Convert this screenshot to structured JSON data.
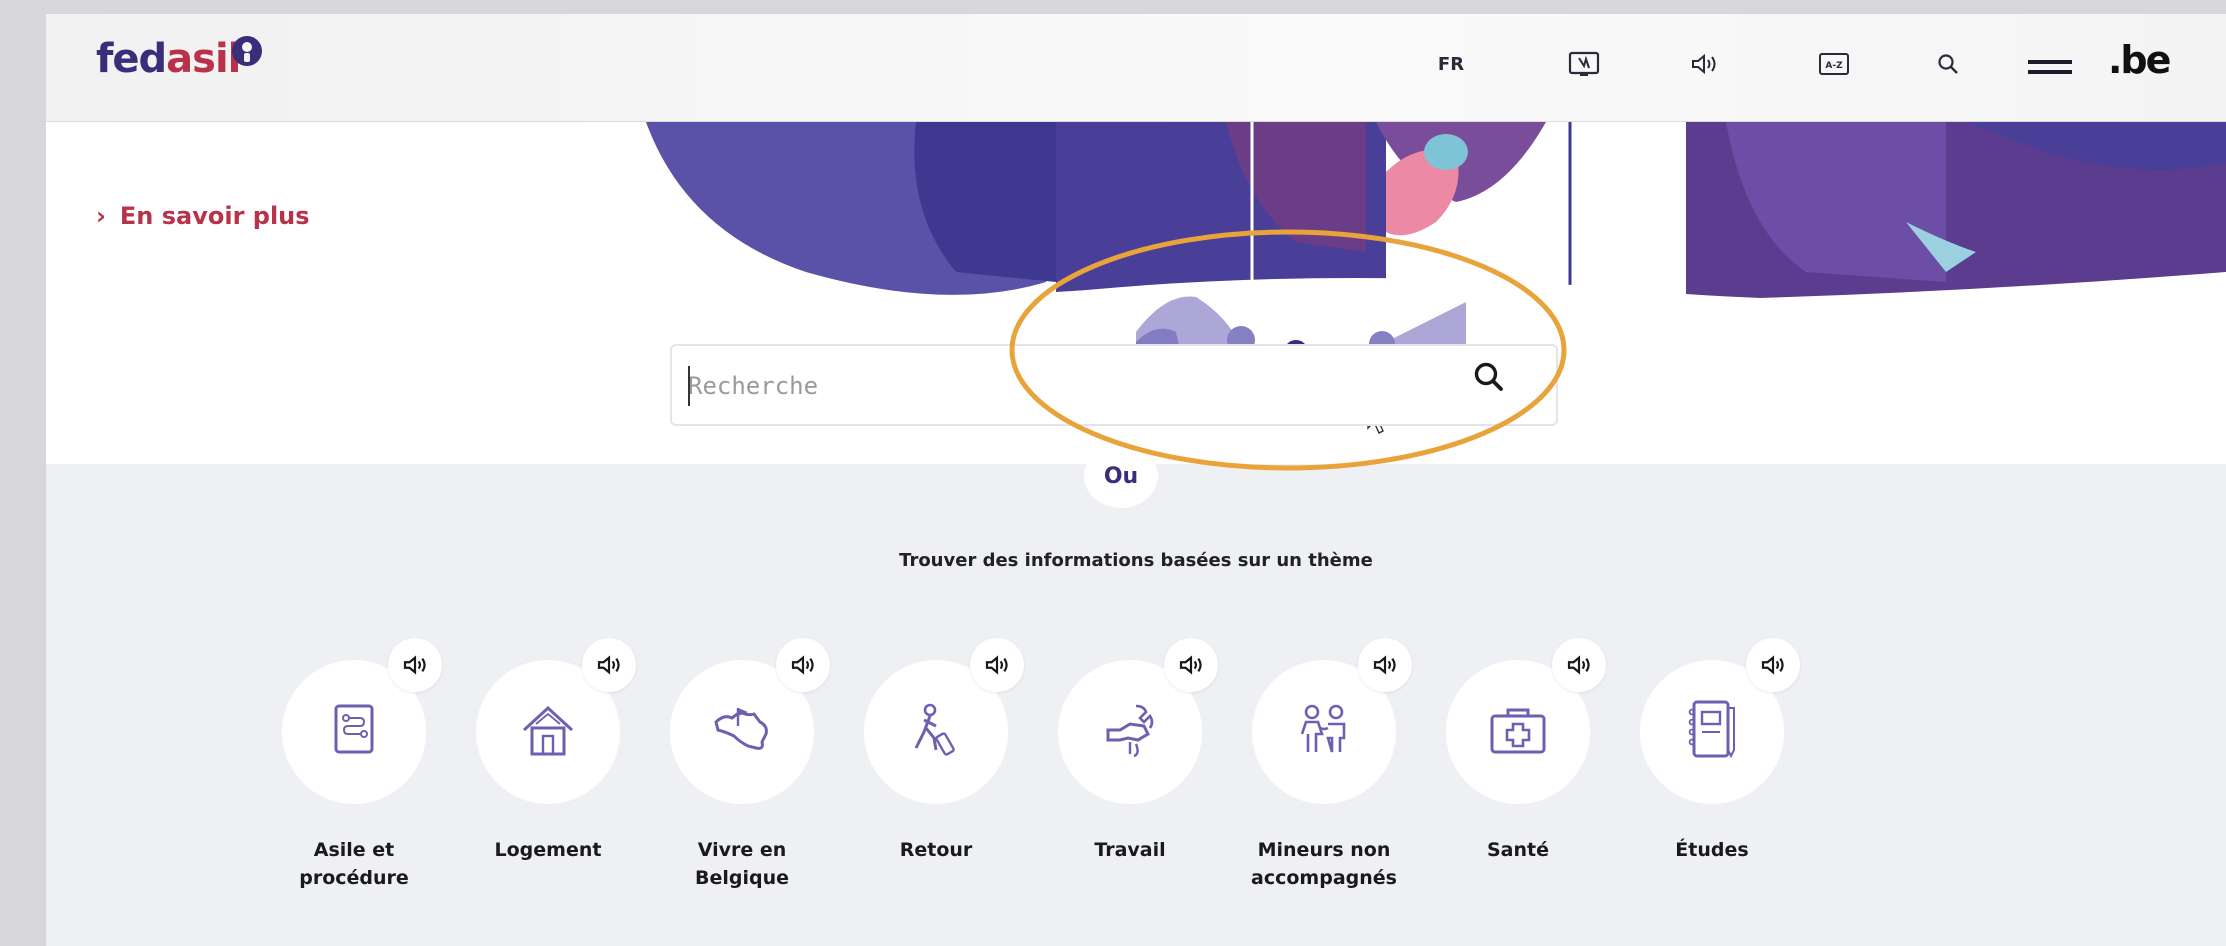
{
  "header": {
    "logo_part1": "fed",
    "logo_part2": "asil",
    "lang": "FR",
    "be": ".be",
    "icons": [
      "sign-language-icon",
      "speaker-icon",
      "glossary-icon",
      "search-icon",
      "menu-icon"
    ]
  },
  "hero": {
    "more_link": "En savoir plus"
  },
  "search": {
    "placeholder": "Recherche"
  },
  "divider_label": "Ou",
  "themes": {
    "title": "Trouver des informations basées sur un thème",
    "items": [
      {
        "label_line1": "Asile et",
        "label_line2": "procédure",
        "icon": "document-flow-icon"
      },
      {
        "label_line1": "Logement",
        "label_line2": "",
        "icon": "house-icon"
      },
      {
        "label_line1": "Vivre en",
        "label_line2": "Belgique",
        "icon": "belgium-map-icon"
      },
      {
        "label_line1": "Retour",
        "label_line2": "",
        "icon": "traveler-icon"
      },
      {
        "label_line1": "Travail",
        "label_line2": "",
        "icon": "handshake-tool-icon"
      },
      {
        "label_line1": "Mineurs non",
        "label_line2": "accompagnés",
        "icon": "children-icon"
      },
      {
        "label_line1": "Santé",
        "label_line2": "",
        "icon": "first-aid-kit-icon"
      },
      {
        "label_line1": "Études",
        "label_line2": "",
        "icon": "notebook-icon"
      }
    ]
  },
  "colors": {
    "brand_purple": "#3a2e7a",
    "brand_red": "#b8324a",
    "icon_purple": "#6a62b0",
    "annotation_orange": "#e8a33a"
  }
}
